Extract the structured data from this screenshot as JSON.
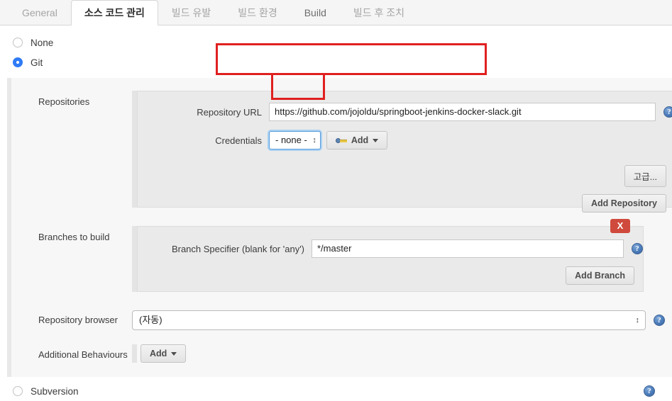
{
  "tabs": [
    {
      "label": "General",
      "active": false,
      "dim": true
    },
    {
      "label": "소스 코드 관리",
      "active": true,
      "dim": false
    },
    {
      "label": "빌드 유발",
      "active": false,
      "dim": true
    },
    {
      "label": "빌드 환경",
      "active": false,
      "dim": true
    },
    {
      "label": "Build",
      "active": false,
      "dim": false
    },
    {
      "label": "빌드 후 조치",
      "active": false,
      "dim": true
    }
  ],
  "scm": {
    "none_label": "None",
    "git_label": "Git",
    "subversion_label": "Subversion"
  },
  "repositories": {
    "section_label": "Repositories",
    "url_label": "Repository URL",
    "url_value": "https://github.com/jojoldu/springboot-jenkins-docker-slack.git",
    "credentials_label": "Credentials",
    "credentials_value": "- none -",
    "add_credentials_label": "Add",
    "advanced_label": "고급...",
    "add_repository_label": "Add Repository"
  },
  "branches": {
    "section_label": "Branches to build",
    "specifier_label": "Branch Specifier (blank for 'any')",
    "specifier_value": "*/master",
    "add_branch_label": "Add Branch",
    "delete_label": "X"
  },
  "repo_browser": {
    "section_label": "Repository browser",
    "value": "(자동)"
  },
  "additional_behaviours": {
    "section_label": "Additional Behaviours",
    "add_label": "Add"
  },
  "icons": {
    "help": "?",
    "key": "key-icon",
    "caret": "chevron-down-icon"
  },
  "colors": {
    "accent_blue": "#2f7bf5",
    "annotation_red": "#e02020",
    "delete_red": "#cf4a3c",
    "panel_gray": "#eaeaea"
  }
}
